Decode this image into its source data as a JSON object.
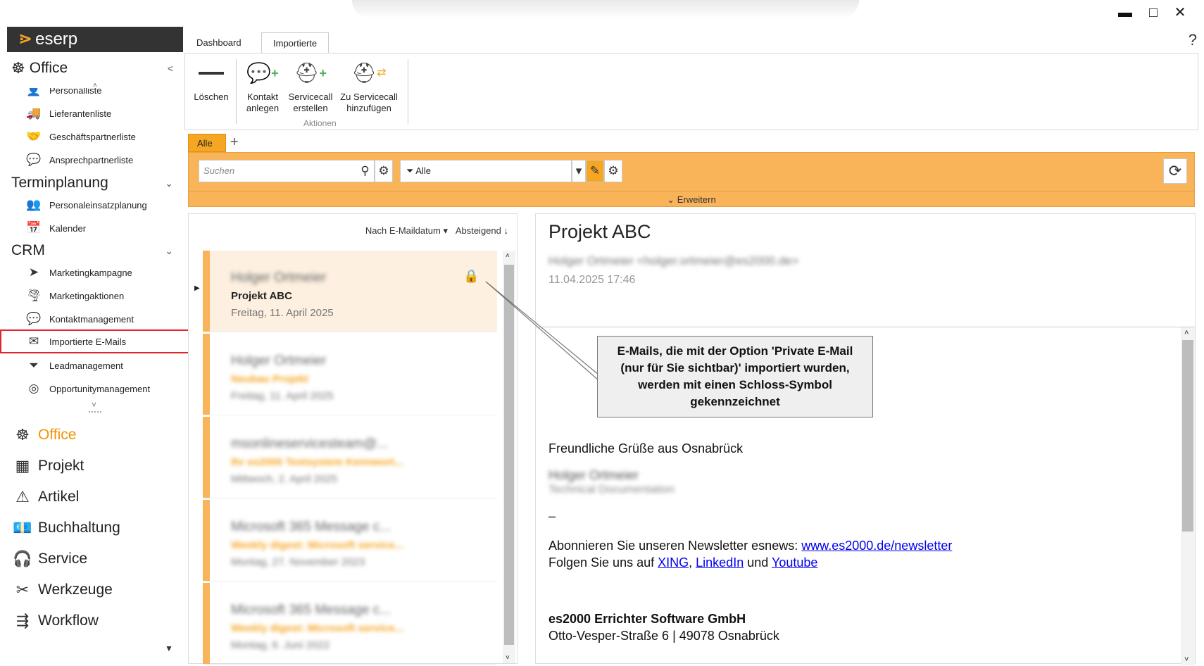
{
  "window": {
    "minimize": "▬",
    "maximize": "□",
    "close": "✕"
  },
  "sidebar": {
    "logo": "eserp",
    "group_office": "Office",
    "items_office": [
      {
        "label": "Personalliste",
        "icon": "person-icon"
      },
      {
        "label": "Lieferantenliste",
        "icon": "truck-icon"
      },
      {
        "label": "Geschäftspartnerliste",
        "icon": "handshake-icon"
      },
      {
        "label": "Ansprechpartnerliste",
        "icon": "contact-icon"
      }
    ],
    "group_termin": "Terminplanung",
    "items_termin": [
      {
        "label": "Personaleinsatzplanung",
        "icon": "staff-plan-icon"
      },
      {
        "label": "Kalender",
        "icon": "calendar-icon"
      }
    ],
    "group_crm": "CRM",
    "items_crm": [
      {
        "label": "Marketingkampagne",
        "icon": "paper-plane-icon"
      },
      {
        "label": "Marketingaktionen",
        "icon": "tornado-icon"
      },
      {
        "label": "Kontaktmanagement",
        "icon": "chat-icon"
      },
      {
        "label": "Importierte E-Mails",
        "icon": "mail-import-icon"
      },
      {
        "label": "Leadmanagement",
        "icon": "funnel-icon"
      },
      {
        "label": "Opportunitymanagement",
        "icon": "target-icon"
      }
    ],
    "modules": [
      {
        "label": "Office",
        "icon": "helm-icon"
      },
      {
        "label": "Projekt",
        "icon": "project-icon"
      },
      {
        "label": "Artikel",
        "icon": "article-icon"
      },
      {
        "label": "Buchhaltung",
        "icon": "cash-icon"
      },
      {
        "label": "Service",
        "icon": "headset-icon"
      },
      {
        "label": "Werkzeuge",
        "icon": "tools-icon"
      },
      {
        "label": "Workflow",
        "icon": "workflow-icon"
      }
    ]
  },
  "tabs": [
    "Dashboard",
    "Importierte E-Mails"
  ],
  "help": "?",
  "ribbon": {
    "delete": "Löschen",
    "contact_create": [
      "Kontakt",
      "anlegen"
    ],
    "servicecall_create": [
      "Servicecall",
      "erstellen"
    ],
    "servicecall_add": [
      "Zu Servicecall",
      "hinzufügen"
    ],
    "group": "Aktionen"
  },
  "toolbar": {
    "subtab": "Alle",
    "subtab_add": "+",
    "search_placeholder": "Suchen",
    "filter_value": "Alle",
    "expand": "Erweitern"
  },
  "list": {
    "sort_by": "Nach E-Maildatum",
    "sort_dir": "Absteigend",
    "rows": [
      {
        "sender": "Holger Ortmeier",
        "subject": "Projekt ABC",
        "date": "Freitag, 11. April 2025"
      },
      {
        "sender": "Holger Ortmeier",
        "subject": "Neubau Projekt",
        "date": "Freitag, 11. April 2025"
      },
      {
        "sender": "msonlineservicesteam@...",
        "subject": "Ihr es2000 Testsystem Kennwort...",
        "date": "Mittwoch, 2. April 2025"
      },
      {
        "sender": "Microsoft 365 Message c...",
        "subject": "Weekly digest: Microsoft service...",
        "date": "Montag, 27. November 2023"
      },
      {
        "sender": "Microsoft 365 Message c...",
        "subject": "Weekly digest: Microsoft service...",
        "date": "Montag, 6. Juni 2022"
      }
    ]
  },
  "reader": {
    "title": "Projekt ABC",
    "from": "Holger Ortmeier <holger.ortmeier@es2000.de>",
    "date": "11.04.2025 17:46",
    "greeting": "Freundliche Grüße aus Osnabrück",
    "sig_name": "Holger Ortmeier",
    "sig_role": "Technical Documentation",
    "dash": "–",
    "newsletter_text": "Abonnieren Sie unseren Newsletter esnews:",
    "newsletter_link": "www.es2000.de/newsletter",
    "follow_text": "Folgen Sie uns auf",
    "xing": "XING",
    "linkedin": "LinkedIn",
    "und": "und",
    "youtube": "Youtube",
    "company": "es2000 Errichter Software GmbH",
    "address": "Otto-Vesper-Straße 6 | 49078 Osnabrück"
  },
  "callout": {
    "line1": "E-Mails, die mit der Option 'Private E-Mail",
    "line2": "(nur für Sie sichtbar)' importiert wurden,",
    "line3": "werden mit einen Schloss-Symbol",
    "line4": "gekennzeichnet"
  },
  "colors": {
    "accent": "#f5a623",
    "toolbar": "#f9b45a",
    "highlight": "#e2242c",
    "link": "#0000ee"
  }
}
